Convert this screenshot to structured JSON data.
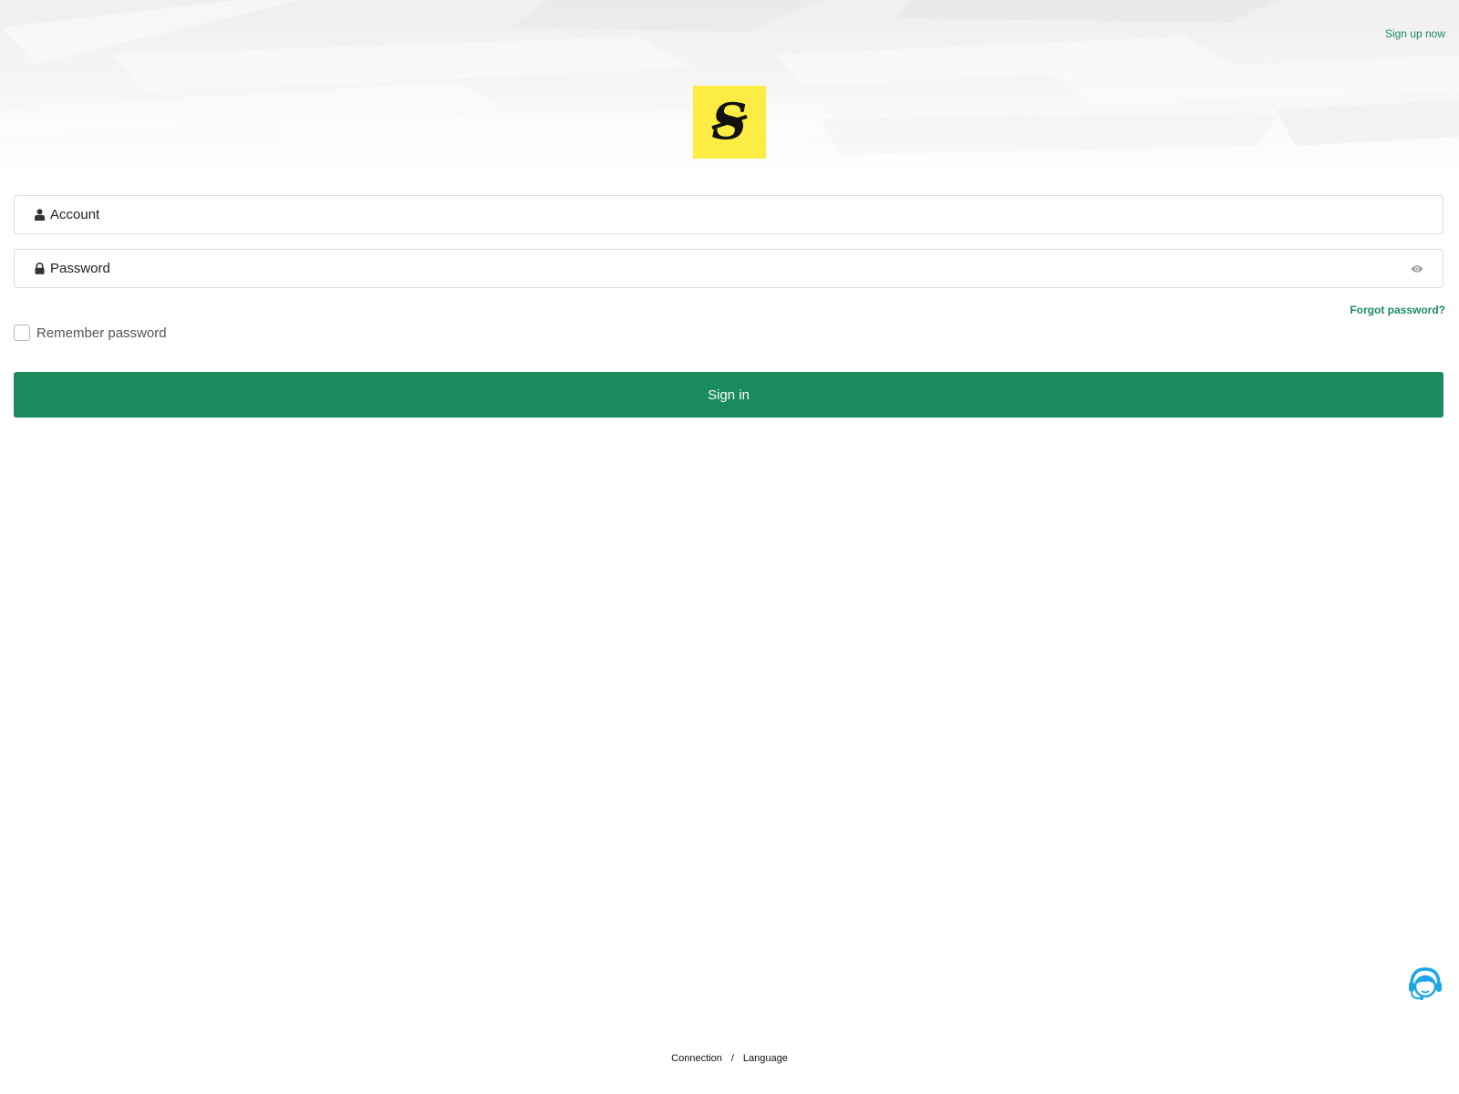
{
  "header": {
    "signup_label": "Sign up now",
    "logo_color": "#fdec44",
    "logo_icon": "gothic-s-logo-icon"
  },
  "login_form": {
    "account": {
      "placeholder": "Account",
      "value": "",
      "icon": "user-icon"
    },
    "password": {
      "placeholder": "Password",
      "value": "",
      "icon": "lock-icon",
      "toggle_icon": "eye-icon"
    },
    "forgot_label": "Forgot password?",
    "remember_label": "Remember password",
    "remember_checked": false,
    "signin_label": "Sign in"
  },
  "support": {
    "icon": "customer-support-headset-icon",
    "color": "#1ea7e8"
  },
  "footer": {
    "connection_label": "Connection",
    "separator": "/",
    "language_label": "Language"
  },
  "colors": {
    "accent": "#1a8a5f",
    "background": "#ffffff",
    "border": "#dcdcdc"
  }
}
